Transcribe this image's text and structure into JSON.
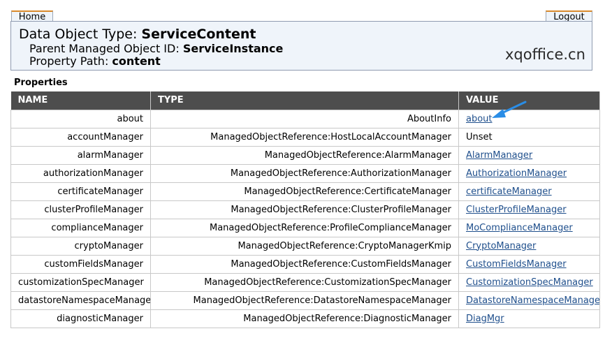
{
  "nav": {
    "home_label": "Home",
    "logout_label": "Logout"
  },
  "header": {
    "type_prefix": "Data Object Type: ",
    "type_value": "ServiceContent",
    "parent_prefix": "Parent Managed Object ID: ",
    "parent_value": "ServiceInstance",
    "path_prefix": "Property Path: ",
    "path_value": "content"
  },
  "watermark": "xqoffice.cn",
  "section_label": "Properties",
  "table": {
    "columns": [
      "NAME",
      "TYPE",
      "VALUE"
    ],
    "rows": [
      {
        "name": "about",
        "type": "AboutInfo",
        "value": "about",
        "link": true
      },
      {
        "name": "accountManager",
        "type": "ManagedObjectReference:HostLocalAccountManager",
        "value": "Unset",
        "link": false
      },
      {
        "name": "alarmManager",
        "type": "ManagedObjectReference:AlarmManager",
        "value": "AlarmManager",
        "link": true
      },
      {
        "name": "authorizationManager",
        "type": "ManagedObjectReference:AuthorizationManager",
        "value": "AuthorizationManager",
        "link": true
      },
      {
        "name": "certificateManager",
        "type": "ManagedObjectReference:CertificateManager",
        "value": "certificateManager",
        "link": true
      },
      {
        "name": "clusterProfileManager",
        "type": "ManagedObjectReference:ClusterProfileManager",
        "value": "ClusterProfileManager",
        "link": true
      },
      {
        "name": "complianceManager",
        "type": "ManagedObjectReference:ProfileComplianceManager",
        "value": "MoComplianceManager",
        "link": true
      },
      {
        "name": "cryptoManager",
        "type": "ManagedObjectReference:CryptoManagerKmip",
        "value": "CryptoManager",
        "link": true
      },
      {
        "name": "customFieldsManager",
        "type": "ManagedObjectReference:CustomFieldsManager",
        "value": "CustomFieldsManager",
        "link": true
      },
      {
        "name": "customizationSpecManager",
        "type": "ManagedObjectReference:CustomizationSpecManager",
        "value": "CustomizationSpecManager",
        "link": true
      },
      {
        "name": "datastoreNamespaceManager",
        "type": "ManagedObjectReference:DatastoreNamespaceManager",
        "value": "DatastoreNamespaceManager",
        "link": true
      },
      {
        "name": "diagnosticManager",
        "type": "ManagedObjectReference:DiagnosticManager",
        "value": "DiagMgr",
        "link": true
      }
    ]
  },
  "colors": {
    "header_bg": "#eff4fa",
    "table_head_bg": "#4d4d4d",
    "link": "#1f4f8c",
    "arrow": "#2a8de6"
  }
}
